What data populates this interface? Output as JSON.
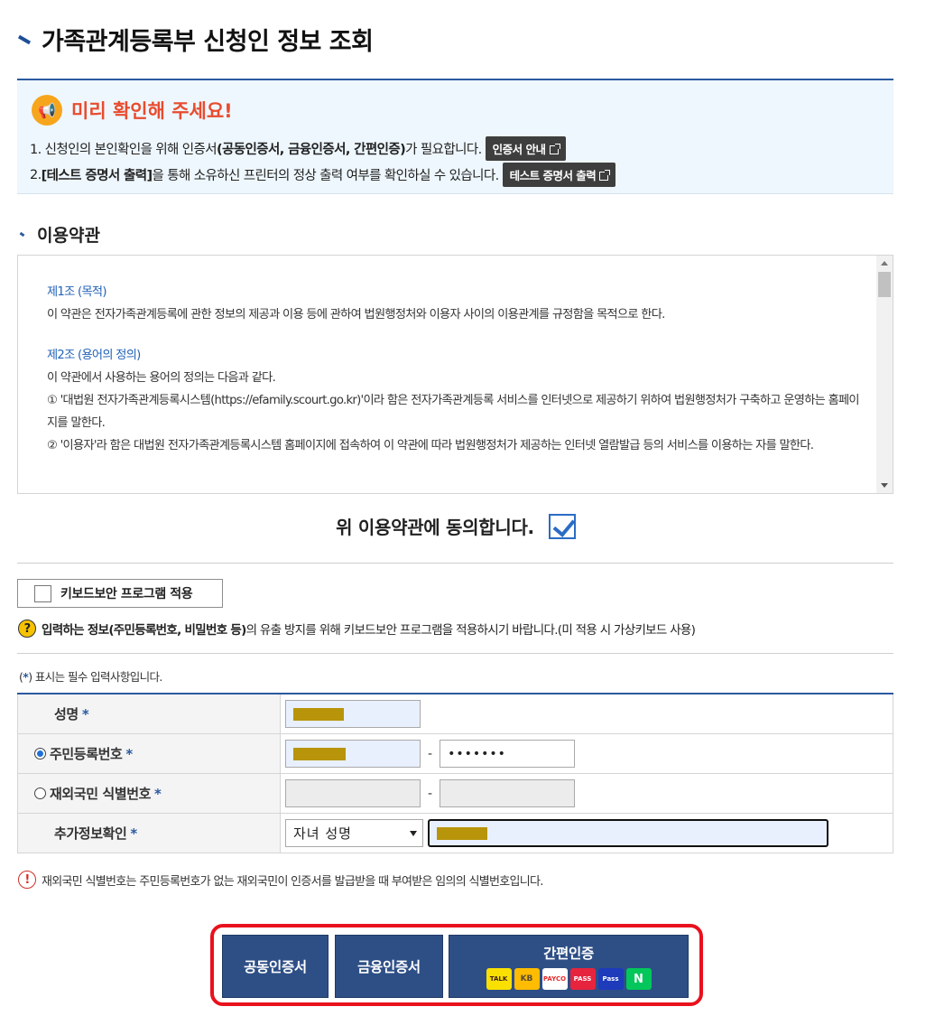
{
  "page": {
    "title": "가족관계등록부 신청인 정보 조회"
  },
  "notice": {
    "heading": "미리 확인해 주세요!",
    "line1_prefix": "1. 신청인의 본인확인을 위해 인증서",
    "line1_bold": "(공동인증서, 금융인증서, 간편인증)",
    "line1_suffix": "가 필요합니다.",
    "line1_button": "인증서 안내",
    "line2_prefix": "2.",
    "line2_bold": "[테스트 증명서 출력]",
    "line2_suffix": "을 통해 소유하신 프린터의 정상 출력 여부를 확인하실 수 있습니다.",
    "line2_button": "테스트 증명서 출력"
  },
  "terms": {
    "section_title": "이용약관",
    "art1_title": "제1조 (목적)",
    "art1_text": "이 약관은 전자가족관계등록에 관한 정보의 제공과 이용 등에 관하여 법원행정처와 이용자 사이의 이용관계를 규정함을 목적으로 한다.",
    "art2_title": "제2조 (용어의 정의)",
    "art2_intro": "이 약관에서 사용하는 용어의 정의는 다음과 같다.",
    "art2_item1": "① '대법원 전자가족관계등록시스템(https://efamily.scourt.go.kr)'이라 함은 전자가족관계등록 서비스를 인터넷으로 제공하기 위하여 법원행정처가 구축하고 운영하는 홈페이지를 말한다.",
    "art2_item2": "② '이용자'라 함은 대법원 전자가족관계등록시스템 홈페이지에 접속하여 이 약관에 따라 법원행정처가 제공하는 인터넷 열람발급 등의 서비스를 이용하는 자를 말한다."
  },
  "agree": {
    "label": "위 이용약관에 동의합니다.",
    "checked": true
  },
  "keyboard": {
    "button_label": "키보드보안 프로그램 적용",
    "note_bold": "입력하는 정보(주민등록번호, 비밀번호 등)",
    "note_text": "의 유출 방지를 위해 키보드보안 프로그램을 적용하시기 바랍니다.(미 적용 시 가상키보드 사용)"
  },
  "form": {
    "required_note_prefix": "(",
    "required_note_star": "*",
    "required_note_suffix": ") 표시는 필수 입력사항입니다.",
    "name_label": "성명",
    "rrn_label": "주민등록번호",
    "rrn_back": "•••••••",
    "foreign_label": "재외국민 식별번호",
    "extra_label": "추가정보확인",
    "extra_select": "자녀 성명",
    "star": "*",
    "dash": "-"
  },
  "warning": {
    "text": "재외국민 식별번호는 주민등록번호가 없는 재외국민이 인증서를 발급받을 때 부여받은 임의의 식별번호입니다."
  },
  "auth": {
    "joint": "공동인증서",
    "financial": "금융인증서",
    "simple": "간편인증",
    "brands": [
      "TALK",
      "KB",
      "PAYCO",
      "PASS",
      "Pass",
      "N"
    ]
  },
  "colors": {
    "accent": "#2b5aa0",
    "auth_button": "#2e4f86",
    "highlight_frame": "#e8111d",
    "notice_title": "#e84c2f"
  }
}
